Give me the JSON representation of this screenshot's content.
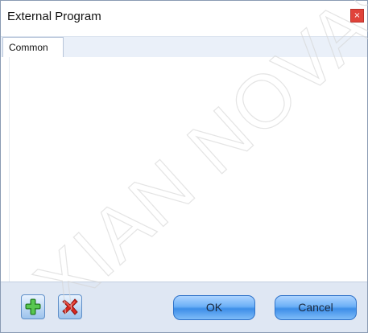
{
  "window": {
    "title": "External Program",
    "close_glyph": "×"
  },
  "tabs": [
    {
      "label": "Common"
    }
  ],
  "footer": {
    "add_icon": "green-plus-icon",
    "remove_icon": "red-x-icon",
    "ok_label": "OK",
    "cancel_label": "Cancel"
  },
  "colors": {
    "close_button": "#e0433a",
    "tab_strip": "#eaf0f9",
    "footer_bar": "#dfe7f3",
    "primary_button": "#4d99ea"
  },
  "watermark": {
    "text": "XIAN NOVASTAR"
  }
}
